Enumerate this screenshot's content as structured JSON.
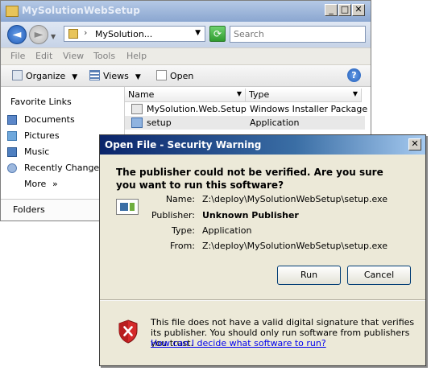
{
  "explorer": {
    "title": "MySolutionWebSetup",
    "address": "MySolution...",
    "search_placeholder": "Search",
    "menu": [
      "File",
      "Edit",
      "View",
      "Tools",
      "Help"
    ],
    "toolbar": {
      "organize": "Organize",
      "views": "Views",
      "open": "Open"
    },
    "favorites_title": "Favorite Links",
    "favorites": [
      "Documents",
      "Pictures",
      "Music",
      "Recently Changed"
    ],
    "more": "More",
    "more_glyph": "»",
    "folders": "Folders",
    "columns": {
      "name": "Name",
      "type": "Type"
    },
    "files": [
      {
        "name": "MySolution.Web.Setup",
        "type": "Windows Installer Package"
      },
      {
        "name": "setup",
        "type": "Application"
      }
    ]
  },
  "dialog": {
    "title": "Open File - Security Warning",
    "question": "The publisher could not be verified.  Are you sure you want to run this software?",
    "fields": [
      {
        "label": "Name:",
        "value": "Z:\\deploy\\MySolutionWebSetup\\setup.exe"
      },
      {
        "label": "Publisher:",
        "value": "Unknown Publisher"
      },
      {
        "label": "Type:",
        "value": "Application"
      },
      {
        "label": "From:",
        "value": "Z:\\deploy\\MySolutionWebSetup\\setup.exe"
      }
    ],
    "run_label": "Run",
    "cancel_label": "Cancel",
    "warning": "This file does not have a valid digital signature that verifies its publisher.  You should only run software from publishers you trust.",
    "help_link": "How can I decide what software to run?"
  },
  "icons": {
    "back": "back-arrow-icon",
    "forward": "forward-arrow-icon",
    "shield": "red-shield-x-icon",
    "help": "help-icon"
  },
  "colors": {
    "dialog_title_start": "#0a246a",
    "link": "#0000ee",
    "selected_row": "#e8e8e8"
  }
}
